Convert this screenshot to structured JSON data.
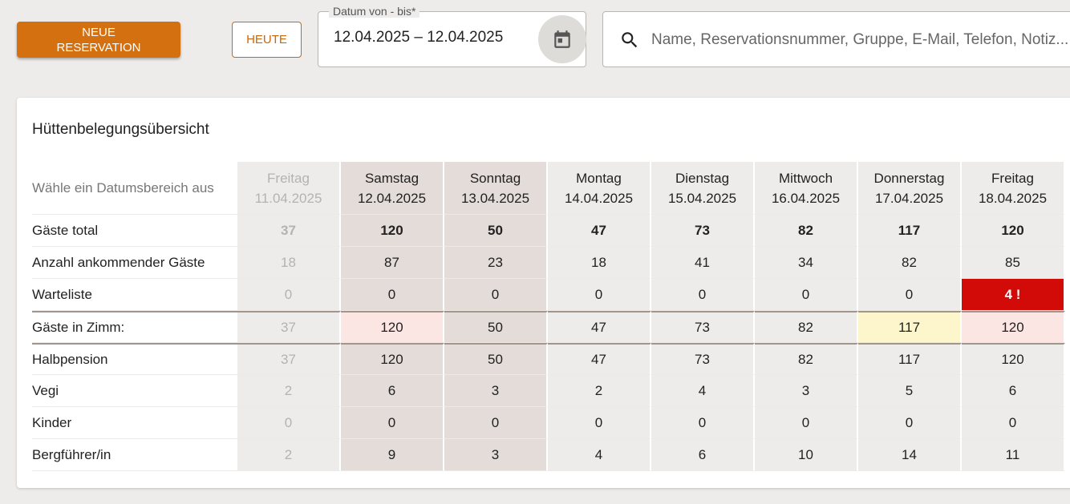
{
  "toolbar": {
    "new_reservation_line1": "NEUE",
    "new_reservation_line2": "RESERVATION",
    "today_label": "HEUTE",
    "date_label": "Datum von - bis*",
    "date_value": "12.04.2025 – 12.04.2025",
    "search_placeholder": "Name, Reservationsnummer, Gruppe, E-Mail, Telefon, Notiz...",
    "icons": {
      "calendar": "calendar-icon",
      "search": "search-icon"
    }
  },
  "colors": {
    "accent": "#d4700f",
    "warning_red": "#d30b08",
    "highlight_pink": "#fce6e4",
    "highlight_yellow": "#fdf5cc"
  },
  "overview": {
    "title": "Hüttenbelegungsübersicht",
    "range_hint": "Wähle ein Datumsbereich aus",
    "days": [
      {
        "weekday": "Freitag",
        "date": "11.04.2025"
      },
      {
        "weekday": "Samstag",
        "date": "12.04.2025"
      },
      {
        "weekday": "Sonntag",
        "date": "13.04.2025"
      },
      {
        "weekday": "Montag",
        "date": "14.04.2025"
      },
      {
        "weekday": "Dienstag",
        "date": "15.04.2025"
      },
      {
        "weekday": "Mittwoch",
        "date": "16.04.2025"
      },
      {
        "weekday": "Donnerstag",
        "date": "17.04.2025"
      },
      {
        "weekday": "Freitag",
        "date": "18.04.2025"
      }
    ],
    "rows": [
      {
        "label": "Gäste total",
        "values": [
          "37",
          "120",
          "50",
          "47",
          "73",
          "82",
          "117",
          "120"
        ]
      },
      {
        "label": "Anzahl ankommender Gäste",
        "values": [
          "18",
          "87",
          "23",
          "18",
          "41",
          "34",
          "82",
          "85"
        ]
      },
      {
        "label": "Warteliste",
        "values": [
          "0",
          "0",
          "0",
          "0",
          "0",
          "0",
          "0",
          "4 !"
        ]
      },
      {
        "label": "Gäste in Zimm:",
        "values": [
          "37",
          "120",
          "50",
          "47",
          "73",
          "82",
          "117",
          "120"
        ]
      },
      {
        "label": "Halbpension",
        "values": [
          "37",
          "120",
          "50",
          "47",
          "73",
          "82",
          "117",
          "120"
        ]
      },
      {
        "label": "Vegi",
        "values": [
          "2",
          "6",
          "3",
          "2",
          "4",
          "3",
          "5",
          "6"
        ]
      },
      {
        "label": "Kinder",
        "values": [
          "0",
          "0",
          "0",
          "0",
          "0",
          "0",
          "0",
          "0"
        ]
      },
      {
        "label": "Bergführer/in",
        "values": [
          "2",
          "9",
          "3",
          "4",
          "6",
          "10",
          "14",
          "11"
        ]
      }
    ]
  }
}
